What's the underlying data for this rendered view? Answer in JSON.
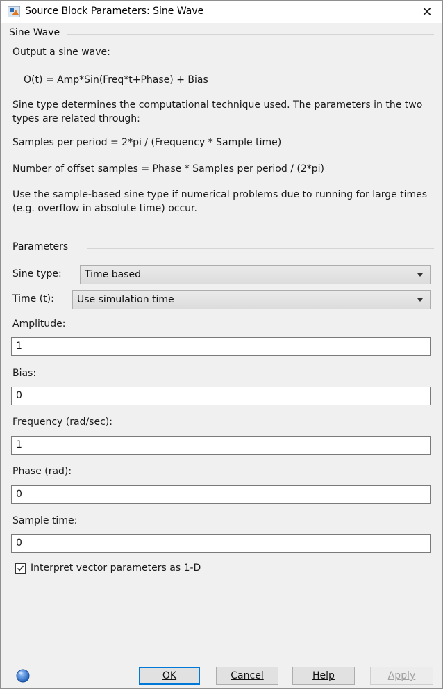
{
  "window": {
    "title": "Source Block Parameters: Sine Wave",
    "close_symbol": "✕"
  },
  "description": {
    "group_title": "Sine Wave",
    "lines": [
      "Output a sine wave:",
      "O(t) = Amp*Sin(Freq*t+Phase) + Bias",
      "Sine type determines the computational technique used. The parameters in the two types are related through:",
      "Samples per period = 2*pi / (Frequency * Sample time)",
      "Number of offset samples = Phase * Samples per period / (2*pi)",
      "Use the sample-based sine type if numerical problems due to running for large times (e.g. overflow in absolute time) occur."
    ]
  },
  "parameters": {
    "group_title": "Parameters",
    "sine_type": {
      "label": "Sine type:",
      "value": "Time based"
    },
    "time": {
      "label": "Time (t):",
      "value": "Use simulation time"
    },
    "amplitude": {
      "label": "Amplitude:",
      "value": "1"
    },
    "bias": {
      "label": "Bias:",
      "value": "0"
    },
    "frequency": {
      "label": "Frequency (rad/sec):",
      "value": "1"
    },
    "phase": {
      "label": "Phase (rad):",
      "value": "0"
    },
    "sample_time": {
      "label": "Sample time:",
      "value": "0"
    },
    "interpret_vector": {
      "label": "Interpret vector parameters as 1-D",
      "checked": true
    }
  },
  "buttons": {
    "ok": "OK",
    "cancel": "Cancel",
    "help": "Help",
    "apply": "Apply"
  },
  "icons": {
    "app": "simulink-icon",
    "help": "help-icon",
    "close": "close-icon"
  },
  "colors": {
    "accent": "#0078d7",
    "dialog_bg": "#f0f0f0"
  }
}
